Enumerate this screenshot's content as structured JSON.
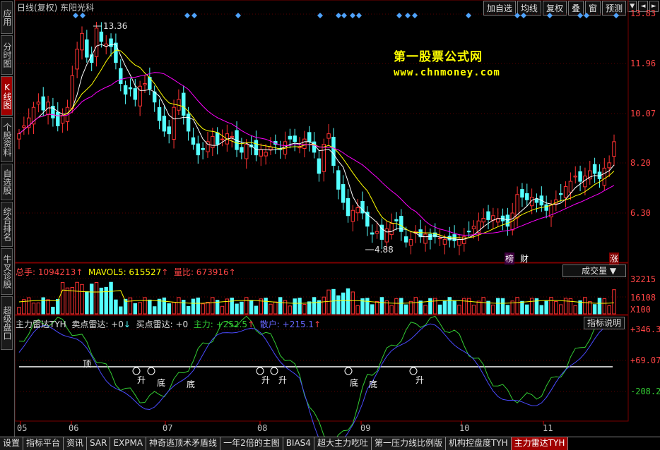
{
  "header": {
    "title": "日线(复权)  东阳光科"
  },
  "top_menu": [
    "加自选",
    "均线",
    "复权",
    "叠",
    "窗",
    "预测"
  ],
  "top_arrows": {
    "down": "▼",
    "left": "◄",
    "right": "►"
  },
  "sidebar": [
    {
      "label": "应用",
      "active": false
    },
    {
      "label": "分时图",
      "active": false
    },
    {
      "label": "K线图",
      "active": true
    },
    {
      "label": "个股资料",
      "active": false
    },
    {
      "label": "自选股",
      "active": false
    },
    {
      "label": "综合排名",
      "active": false
    },
    {
      "label": "牛叉诊股",
      "active": false
    },
    {
      "label": "超级盘口",
      "active": false
    }
  ],
  "watermark": {
    "line1": "第一股票公式网",
    "line2": "www.chnmoney.com"
  },
  "price_axis": [
    "13.83",
    "11.96",
    "10.07",
    "8.20",
    "6.30"
  ],
  "price_annotations": {
    "high": "13.36",
    "low": "4.88"
  },
  "markers": {
    "bang": "榜",
    "cai": "财",
    "zhang": "涨"
  },
  "volume": {
    "total": "总手: 1094213",
    "mavol5": "MAVOL5: 615527",
    "ratio": "量比: 673916",
    "axis": [
      "32215",
      "16108"
    ],
    "unit": "X100",
    "selector": "成交量 ▼"
  },
  "indicator": {
    "name": "主力雷达TYH",
    "sell": "卖点雷达: +0",
    "buy": "买点雷达: +0",
    "zhuli": "主力: +252.5",
    "sanhu": "散户: +215.1",
    "axis": [
      "+346.3",
      "+69.07",
      "-208.2"
    ],
    "help": "指标说明",
    "labels": {
      "top": "顶",
      "up": "升",
      "bottom": "底"
    }
  },
  "x_axis": [
    "05",
    "06",
    "07",
    "08",
    "09",
    "10",
    "11"
  ],
  "bottom_tabs": [
    "设置",
    "指标平台",
    "资讯",
    "SAR",
    "EXPMA",
    "神奇逃顶术矛盾线",
    "一年2倍的主图",
    "BIAS4",
    "超大主力吃吐",
    "第一压力线比例版",
    "机构控盘度TYH",
    "主力雷达TYH"
  ],
  "colors": {
    "up": "#ff3232",
    "down": "#54ffff",
    "ma": "#ffffff",
    "marker": "#4fa3ff",
    "axis_red": "#ff4444",
    "indicator_green": "#33cc33",
    "indicator_blue": "#4444ff"
  },
  "chart_data": {
    "type": "candlestick",
    "closes": [
      9.3,
      9.6,
      9.9,
      10.3,
      10.5,
      10.2,
      10.5,
      9.9,
      9.6,
      10.0,
      10.3,
      11.5,
      12.5,
      13.1,
      12.2,
      12.0,
      13.3,
      12.8,
      12.7,
      12.6,
      12.0,
      11.2,
      10.8,
      11.0,
      10.6,
      11.1,
      11.2,
      11.0,
      10.5,
      9.8,
      9.4,
      9.3,
      10.3,
      10.6,
      10.0,
      9.4,
      8.9,
      8.5,
      8.7,
      9.0,
      9.2,
      8.9,
      9.1,
      9.3,
      9.2,
      8.7,
      8.6,
      8.9,
      8.8,
      8.5,
      8.7,
      8.6,
      8.8,
      8.9,
      8.7,
      9.0,
      9.1,
      9.0,
      8.8,
      9.1,
      9.0,
      8.6,
      7.8,
      8.9,
      9.3,
      8.1,
      7.2,
      6.7,
      6.2,
      6.4,
      6.5,
      6.3,
      5.8,
      5.5,
      5.6,
      5.3,
      5.7,
      5.9,
      6.0,
      5.6,
      5.2,
      5.3,
      5.6,
      5.4,
      5.5,
      5.3,
      5.4,
      5.35,
      5.3,
      5.28,
      5.25,
      5.3,
      5.4,
      5.6,
      5.8,
      6.0,
      6.1,
      6.05,
      6.2,
      6.1,
      6.0,
      5.8,
      6.3,
      7.0,
      6.9,
      6.8,
      6.9,
      6.7,
      6.6,
      6.4,
      6.6,
      6.8,
      7.0,
      7.3,
      7.5,
      7.7,
      7.5,
      7.7,
      7.9,
      7.8,
      7.6,
      8.0,
      8.2,
      9.0
    ]
  }
}
